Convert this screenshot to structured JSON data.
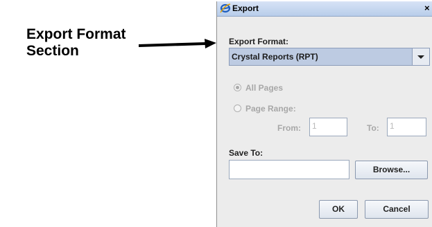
{
  "annotation": {
    "text_line1": "Export Format",
    "text_line2": "Section"
  },
  "dialog": {
    "title": "Export",
    "close_glyph": "×",
    "export_format_label": "Export Format:",
    "export_format_value": "Crystal Reports (RPT)",
    "page_options": {
      "all_pages_label": "All Pages",
      "page_range_label": "Page Range:",
      "from_label": "From:",
      "from_value": "1",
      "to_label": "To:",
      "to_value": "1",
      "selected": "all_pages"
    },
    "save_to_label": "Save To:",
    "save_to_value": "",
    "browse_label": "Browse...",
    "ok_label": "OK",
    "cancel_label": "Cancel"
  },
  "icons": [
    "app-icon",
    "close-icon",
    "dropdown-arrow-icon",
    "annotation-arrow"
  ],
  "colors": {
    "titlebar": "#c9d8f0",
    "combo_bg": "#bdcbe2",
    "dialog_bg": "#ececec",
    "disabled_text": "#a7a7a7"
  }
}
